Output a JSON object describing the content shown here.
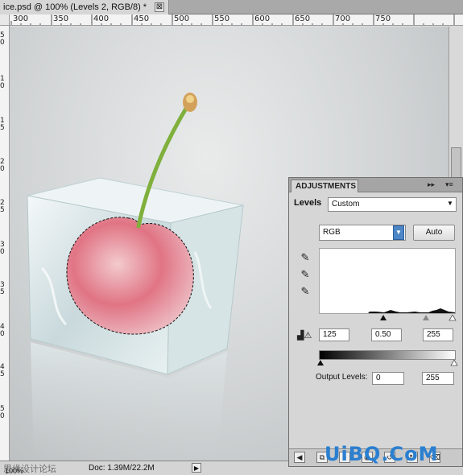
{
  "document": {
    "tab_title": "ice.psd @ 100% (Levels 2, RGB/8) *",
    "close_glyph": "⊠"
  },
  "rulers": {
    "top": [
      "300",
      "350",
      "400",
      "450",
      "500",
      "550",
      "600",
      "650",
      "700",
      "750"
    ],
    "left": [
      "5",
      "0",
      "1",
      "0",
      "1",
      "5",
      "2",
      "0",
      "2",
      "5",
      "3",
      "0",
      "3",
      "5",
      "4",
      "0",
      "4",
      "5",
      "5",
      "0"
    ]
  },
  "status": {
    "zoom": "100%",
    "forum": "思缘设计论坛",
    "doc_info": "Doc: 1.39M/22.2M",
    "arrow_glyph": "▶"
  },
  "adjustments": {
    "tab_label": "ADJUSTMENTS",
    "collapse_glyph": "▸▸",
    "menu_glyph": "▾≡",
    "levels_label": "Levels",
    "preset_value": "Custom",
    "channel_value": "RGB",
    "auto_label": "Auto",
    "input_levels": [
      "125",
      "0.50",
      "255"
    ],
    "output_label": "Output Levels:",
    "output_levels": [
      "0",
      "255"
    ]
  },
  "watermark": "UiBQ.CoM",
  "colors": {
    "accent": "#4d86c6",
    "watermark": "#2a7fd0"
  }
}
